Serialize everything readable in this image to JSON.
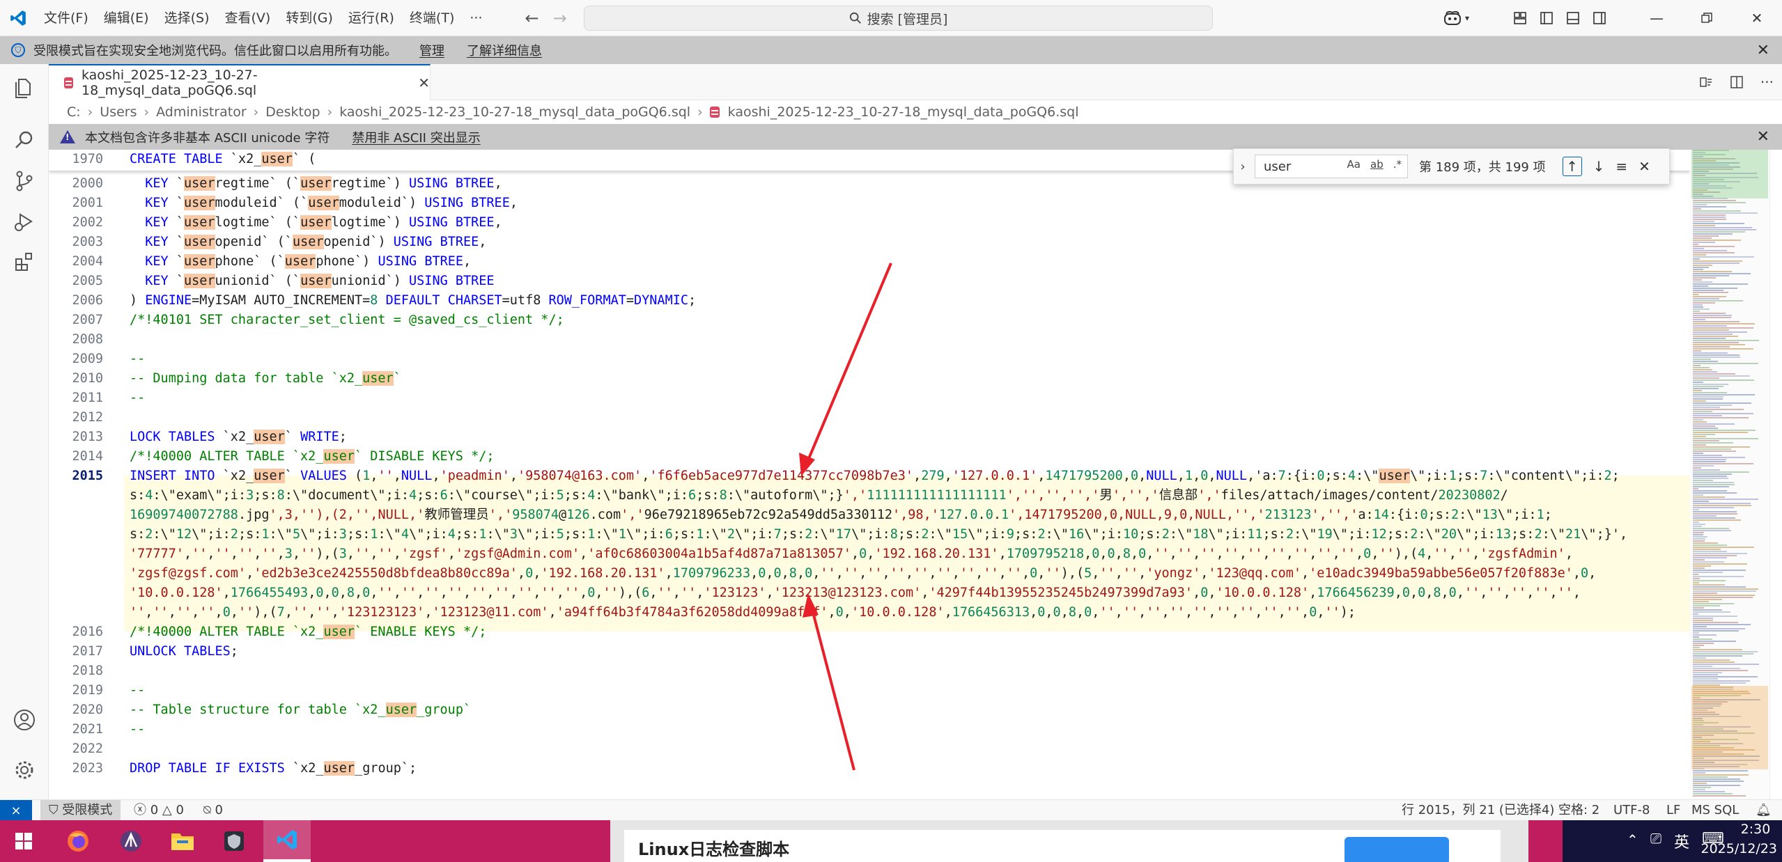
{
  "titlebar": {
    "menus": [
      "文件(F)",
      "编辑(E)",
      "选择(S)",
      "查看(V)",
      "转到(G)",
      "运行(R)",
      "终端(T)"
    ],
    "more": "···",
    "search": "搜索 [管理员]"
  },
  "restricted_banner": {
    "text": "受限模式旨在实现安全地浏览代码。信任此窗口以启用所有功能。",
    "manage": "管理",
    "learn_more": "了解详细信息"
  },
  "tab": {
    "label": "kaoshi_2025-12-23_10-27-18_mysql_data_poGQ6.sql"
  },
  "breadcrumb": [
    "C:",
    "Users",
    "Administrator",
    "Desktop",
    "kaoshi_2025-12-23_10-27-18_mysql_data_poGQ6.sql",
    "kaoshi_2025-12-23_10-27-18_mysql_data_poGQ6.sql"
  ],
  "unicode_banner": {
    "text": "本文档包含许多非基本 ASCII unicode 字符",
    "disable": "禁用非 ASCII 突出显示"
  },
  "find": {
    "query": "user",
    "opt_case": "Aa",
    "opt_word": "ab",
    "opt_regex": ".*",
    "count": "第 189 项，共 199 项"
  },
  "code": {
    "sticky_line": {
      "num": "1970",
      "text": "CREATE TABLE `x2_user` ("
    },
    "lines": [
      {
        "num": "2000",
        "text": "  KEY `userregtime` (`userregtime`) USING BTREE,"
      },
      {
        "num": "2001",
        "text": "  KEY `usermoduleid` (`usermoduleid`) USING BTREE,"
      },
      {
        "num": "2002",
        "text": "  KEY `userlogtime` (`userlogtime`) USING BTREE,"
      },
      {
        "num": "2003",
        "text": "  KEY `useropenid` (`useropenid`) USING BTREE,"
      },
      {
        "num": "2004",
        "text": "  KEY `userphone` (`userphone`) USING BTREE,"
      },
      {
        "num": "2005",
        "text": "  KEY `userunionid` (`userunionid`) USING BTREE"
      },
      {
        "num": "2006",
        "text": ") ENGINE=MyISAM AUTO_INCREMENT=8 DEFAULT CHARSET=utf8 ROW_FORMAT=DYNAMIC;"
      },
      {
        "num": "2007",
        "text": "/*!40101 SET character_set_client = @saved_cs_client */;"
      },
      {
        "num": "2008",
        "text": ""
      },
      {
        "num": "2009",
        "text": "--"
      },
      {
        "num": "2010",
        "text": "-- Dumping data for table `x2_user`"
      },
      {
        "num": "2011",
        "text": "--"
      },
      {
        "num": "2012",
        "text": ""
      },
      {
        "num": "2013",
        "text": "LOCK TABLES `x2_user` WRITE;"
      },
      {
        "num": "2014",
        "text": "/*!40000 ALTER TABLE `x2_user` DISABLE KEYS */;"
      }
    ],
    "insert_num": "2015",
    "insert_wrapped": [
      "INSERT INTO `x2_user` VALUES (1,'',NULL,'peadmin','958074@163.com','f6f6eb5ace977d7e114377cc7098b7e3',279,'127.0.0.1',1471795200,0,NULL,1,0,NULL,'a:7:{i:0;s:4:\\\"user\\\";i:1;s:7:\\\"content\\\";i:2;",
      "s:4:\\\"exam\\\";i:3;s:8:\\\"document\\\";i:4;s:6:\\\"course\\\";i:5;s:4:\\\"bank\\\";i:6;s:8:\\\"autoform\\\";}','111111111111111111','','','','男','','信息部','files/attach/images/content/20230802/",
      "16909740072788.jpg',3,''),(2,'',NULL,'教师管理员','958074@126.com','96e79218965eb72c92a549dd5a330112',98,'127.0.0.1',1471795200,0,NULL,9,0,NULL,'','213123','','a:14:{i:0;s:2:\\\"13\\\";i:1;",
      "s:2:\\\"12\\\";i:2;s:1:\\\"5\\\";i:3;s:1:\\\"4\\\";i:4;s:1:\\\"3\\\";i:5;s:1:\\\"1\\\";i:6;s:1:\\\"2\\\";i:7;s:2:\\\"17\\\";i:8;s:2:\\\"15\\\";i:9;s:2:\\\"16\\\";i:10;s:2:\\\"18\\\";i:11;s:2:\\\"19\\\";i:12;s:2:\\\"20\\\";i:13;s:2:\\\"21\\\";}',",
      "'77777','','','','',3,''),(3,'','','zgsf','zgsf@Admin.com','af0c68603004a1b5af4d87a71a813057',0,'192.168.20.131',1709795218,0,0,8,0,'','','','','','','','','',0,''),(4,'','','zgsfAdmin',",
      "'zgsf@zgsf.com','ed2b3e3ce2425550d8bfdea8b80cc89a',0,'192.168.20.131',1709796233,0,0,8,0,'','','','','','','','','',0,''),(5,'','','yongz','123@qq.com','e10adc3949ba59abbe56e057f20f883e',0,",
      "'10.0.0.128',1766455493,0,0,8,0,'','','','','','','','','',0,''),(6,'','','123123','123213@123123.com','4297f44b13955235245b2497399d7a93',0,'10.0.0.128',1766456239,0,0,8,0,'','','','','',",
      "'','','','',0,''),(7,'','','123123123','123123@11.com','a94ff64b3f4784a3f62058dd4099a8f8f',0,'10.0.0.128',1766456313,0,0,8,0,'','','','','','','','','',0,'');"
    ],
    "after_lines": [
      {
        "num": "2016",
        "text": "/*!40000 ALTER TABLE `x2_user` ENABLE KEYS */;"
      },
      {
        "num": "2017",
        "text": "UNLOCK TABLES;"
      },
      {
        "num": "2018",
        "text": ""
      },
      {
        "num": "2019",
        "text": "--"
      },
      {
        "num": "2020",
        "text": "-- Table structure for table `x2_user_group`"
      },
      {
        "num": "2021",
        "text": "--"
      },
      {
        "num": "2022",
        "text": ""
      },
      {
        "num": "2023",
        "text": "DROP TABLE IF EXISTS `x2_user_group`;"
      }
    ]
  },
  "statusbar": {
    "restricted": "受限模式",
    "errors": "0",
    "warnings": "0",
    "ports": "0",
    "position": "行 2015，列 21 (已选择4)",
    "spaces": "空格: 2",
    "encoding": "UTF-8",
    "eol": "LF",
    "language": "MS SQL"
  },
  "taskbar": {
    "preview_title": "Linux日志检查脚本",
    "ime": "英",
    "time": "2:30",
    "date": "2025/12/23"
  },
  "colors": {
    "accent": "#005fb8",
    "find_highlight": "#f9c9a5",
    "current_line": "#fffce1",
    "taskbar": "#bf1d5d",
    "annotation_arrow": "#e8202a"
  }
}
